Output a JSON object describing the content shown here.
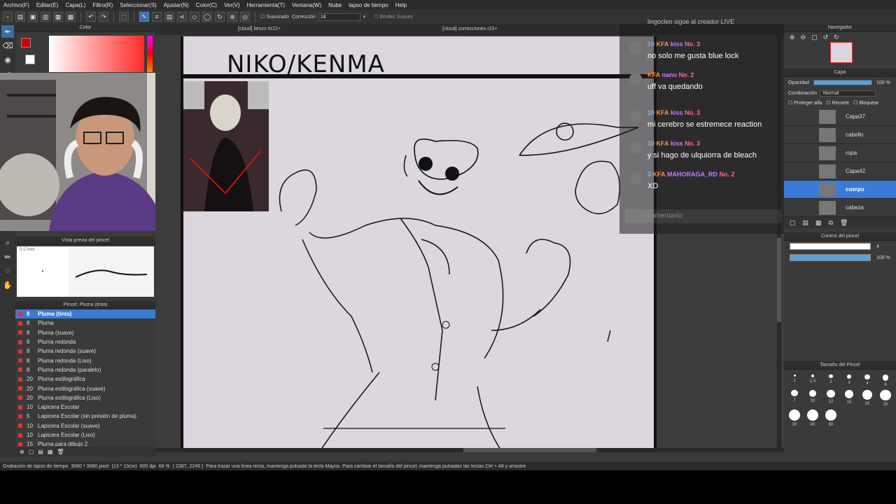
{
  "menu": [
    "Archivo(F)",
    "Editar(E)",
    "Capa(L)",
    "Filtro(R)",
    "Seleccionar(S)",
    "Ajustar(N)",
    "Color(C)",
    "Ver(V)",
    "Herramienta(T)",
    "Ventana(W)",
    "Nube",
    "lapso de tiempo",
    "Help"
  ],
  "toolbar": {
    "suavizado_label": "Suavizado",
    "correccion_label": "Corrección",
    "correccion_value": "18",
    "bordes_label": "Bordes Suaves"
  },
  "panels": {
    "color_title": "Color",
    "brush_preview_title": "Vista previa del pincel",
    "brush_size_readout": "0.17mm",
    "brush_list_title": "Pincel: Pluma (tinta)",
    "navigator_title": "Navegador",
    "layer_title": "Capa",
    "brush_control_title": "Control del pincel",
    "brush_size_title": "Tamaño del Pincel"
  },
  "brushes": [
    {
      "size": "8",
      "name": "Pluma (tinta)",
      "selected": true
    },
    {
      "size": "8",
      "name": "Pluma"
    },
    {
      "size": "8",
      "name": "Pluma (suave)"
    },
    {
      "size": "8",
      "name": "Pluma redonda"
    },
    {
      "size": "8",
      "name": "Pluma redonda (suave)"
    },
    {
      "size": "8",
      "name": "Pluma redonda (Liso)"
    },
    {
      "size": "8",
      "name": "Pluma redonda (paralelo)"
    },
    {
      "size": "20",
      "name": "Pluma estilográfica"
    },
    {
      "size": "20",
      "name": "Pluma estilográfica (suave)"
    },
    {
      "size": "20",
      "name": "Pluma estilográfica (Liso)"
    },
    {
      "size": "10",
      "name": "Lapicera Escolar"
    },
    {
      "size": "5",
      "name": "Lapicera Escolar (sin presión de pluma)"
    },
    {
      "size": "10",
      "name": "Lapicera Escolar (suave)"
    },
    {
      "size": "10",
      "name": "Lapicera Escolar (Liso)"
    },
    {
      "size": "15",
      "name": "Pluma para dibujo 2"
    }
  ],
  "canvas_tabs": [
    "[cloud] lienzo 6r22+",
    "[cloud] correcciones r23+"
  ],
  "canvas": {
    "title_text": "NIKO/KENMA"
  },
  "chat": {
    "header": "lingocleo  sigue al creador LIVE",
    "messages": [
      {
        "level": "10",
        "tag": "KFA",
        "user": "kiss",
        "rank": "No. 3",
        "text": "no solo me gusta blue lock"
      },
      {
        "level": "",
        "tag": "KFA",
        "user": "nanu",
        "rank": "No. 2",
        "text": "uff va quedando"
      },
      {
        "level": "10",
        "tag": "KFA",
        "user": "kiss",
        "rank": "No. 3",
        "text": "mi cerebro se estremece reaction"
      },
      {
        "level": "10",
        "tag": "KFA",
        "user": "kiss",
        "rank": "No. 3",
        "text": "y si hago de ulquiorra de bleach"
      },
      {
        "level": "3",
        "tag": "KFA",
        "user": "MAHORAGA_RD",
        "rank": "No. 2",
        "text": "XD"
      }
    ],
    "input_placeholder": "comentario"
  },
  "layers": {
    "opacity_label": "Opacidad",
    "opacity_value": "100 %",
    "opacity_fraction": 1.0,
    "blend_label": "Combinación",
    "blend_value": "Normal",
    "protect_label": "Proteger alfa",
    "clip_label": "Recorte",
    "lock_label": "Bloquear",
    "items": [
      {
        "name": "Capa37"
      },
      {
        "name": "cabello"
      },
      {
        "name": "ropa"
      },
      {
        "name": "Capa42"
      },
      {
        "name": "cuerpo",
        "selected": true
      },
      {
        "name": "cabeza"
      }
    ]
  },
  "brush_control": {
    "size_value": "4",
    "opacity_value": "100 %"
  },
  "brush_sizes": [
    "1",
    "1.5",
    "2",
    "3",
    "4",
    "6",
    "7",
    "10",
    "12",
    "15",
    "20",
    "25",
    "30",
    "40",
    "50"
  ],
  "status": {
    "text": "Grabación de lapso de tiempo",
    "dimensions": "3080 * 3080 pixel",
    "physical": "(13 * 13cm)",
    "dpi": "600 dpi",
    "zoom": "66 %",
    "coords": "( 2387, 2249 )",
    "hint": "Para trazar una línea recta, mantenga pulsada la tecla Mayús. Para cambiar el tamaño del pincel, mantenga pulsadas las teclas Ctrl + Alt y arrastre"
  }
}
